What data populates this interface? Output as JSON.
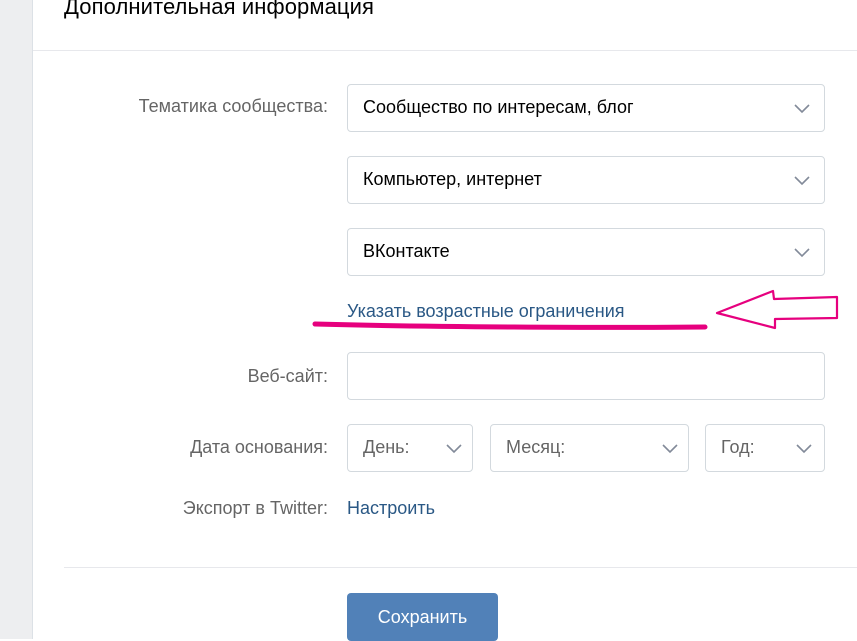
{
  "section": {
    "title": "Дополнительная информация"
  },
  "topic": {
    "label": "Тематика сообщества:",
    "category": "Сообщество по интересам, блог",
    "subcategory": "Компьютер, интернет",
    "subcategory2": "ВКонтакте",
    "age_limits_link": "Указать возрастные ограничения"
  },
  "website": {
    "label": "Веб-сайт:",
    "value": ""
  },
  "founding_date": {
    "label": "Дата основания:",
    "day": "День:",
    "month": "Месяц:",
    "year": "Год:"
  },
  "twitter_export": {
    "label": "Экспорт в Twitter:",
    "link": "Настроить"
  },
  "actions": {
    "save": "Сохранить"
  },
  "colors": {
    "link": "#2a5885",
    "button": "#5181b8",
    "annotation": "#e6007e"
  },
  "annotation": {
    "shape": "arrow-with-underline",
    "target": "age_limits_link"
  }
}
